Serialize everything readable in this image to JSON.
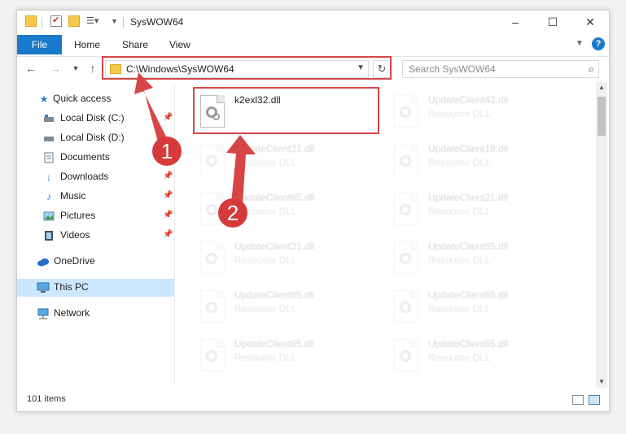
{
  "window": {
    "title": "SysWOW64",
    "controls": [
      "–",
      "☐",
      "✕"
    ]
  },
  "ribbon": {
    "file": "File",
    "tabs": [
      "Home",
      "Share",
      "View"
    ],
    "help": "?"
  },
  "address": {
    "path": "C:\\Windows\\SysWOW64",
    "search_placeholder": "Search SysWOW64"
  },
  "sidebar": {
    "items": [
      {
        "label": "Quick access",
        "icon": "star-icon"
      },
      {
        "label": "Local Disk (C:)",
        "icon": "drive-icon"
      },
      {
        "label": "Local Disk (D:)",
        "icon": "drive-icon"
      },
      {
        "label": "Documents",
        "icon": "documents-icon"
      },
      {
        "label": "Downloads",
        "icon": "download-icon"
      },
      {
        "label": "Music",
        "icon": "music-icon"
      },
      {
        "label": "Pictures",
        "icon": "pictures-icon"
      },
      {
        "label": "Videos",
        "icon": "videos-icon"
      },
      {
        "label": "OneDrive",
        "icon": "cloud-icon"
      },
      {
        "label": "This PC",
        "icon": "computer-icon",
        "selected": true
      },
      {
        "label": "Network",
        "icon": "network-icon"
      }
    ]
  },
  "files": {
    "highlighted": {
      "name": "k2exl32.dll"
    },
    "faded": [
      {
        "name": "UpdateClient42.dll",
        "type": "Resource DLL"
      },
      {
        "name": "UpdateClient21.dll",
        "type": "Resource DLL"
      },
      {
        "name": "UpdateClient19.dll",
        "type": "Resource DLL"
      },
      {
        "name": "UpdateClient65.dll",
        "type": "Resource DLL"
      },
      {
        "name": "UpdateClient21.dll",
        "type": "Resource DLL"
      },
      {
        "name": "UpdateClient21.dll",
        "type": "Resource DLL"
      },
      {
        "name": "UpdateClient65.dll",
        "type": "Resource DLL"
      },
      {
        "name": "UpdateClient65.dll",
        "type": "Resource DLL"
      },
      {
        "name": "UpdateClient65.dll",
        "type": "Resource DLL"
      },
      {
        "name": "UpdateClient65.dll",
        "type": "Resource DLL"
      },
      {
        "name": "UpdateClient65.dll",
        "type": "Resource DLL"
      }
    ]
  },
  "status": {
    "item_count": "101 items"
  },
  "callouts": [
    "1",
    "2"
  ],
  "colors": {
    "accent": "#1979ca",
    "annotation_red": "#d64646",
    "selection": "#cce8ff"
  }
}
